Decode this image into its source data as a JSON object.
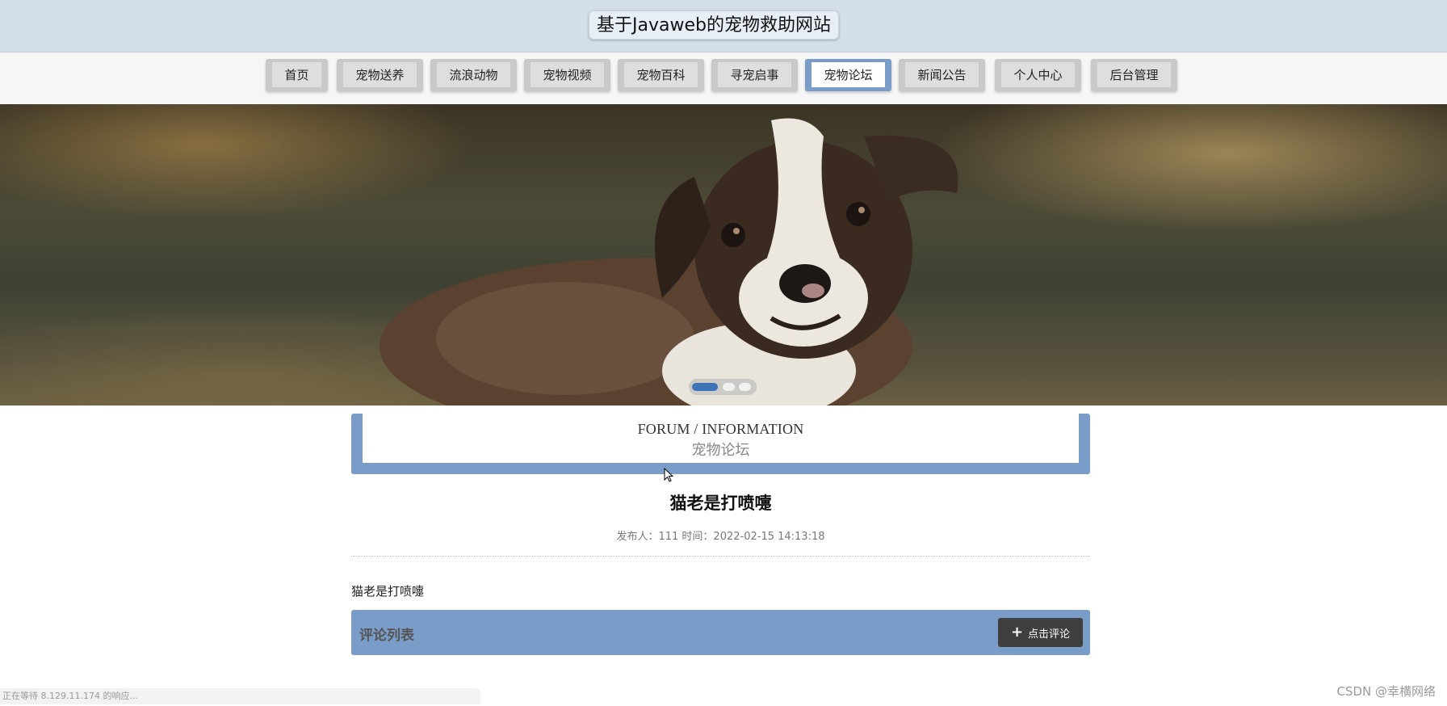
{
  "header": {
    "title": "基于Javaweb的宠物救助网站"
  },
  "nav": {
    "items": [
      {
        "label": "首页"
      },
      {
        "label": "宠物送养"
      },
      {
        "label": "流浪动物"
      },
      {
        "label": "宠物视频"
      },
      {
        "label": "宠物百科"
      },
      {
        "label": "寻宠启事"
      },
      {
        "label": "宠物论坛",
        "active": true
      },
      {
        "label": "新闻公告"
      },
      {
        "label": "个人中心"
      },
      {
        "label": "后台管理"
      }
    ]
  },
  "banner": {
    "image": "puppy-photo",
    "slides": 3,
    "active_slide": 1
  },
  "section": {
    "en": "FORUM / INFORMATION",
    "cn": "宠物论坛"
  },
  "article": {
    "title": "猫老是打喷嚏",
    "meta": "发布人：111 时间：2022-02-15 14:13:18",
    "body": "猫老是打喷嚏"
  },
  "comments": {
    "title": "评论列表",
    "button_label": "点击评论",
    "button_icon": "plus-icon"
  },
  "status_bar": {
    "text": "正在等待 8.129.11.174 的响应..."
  },
  "watermark": {
    "text": "CSDN @幸横网络"
  },
  "colors": {
    "header_bg": "#d4dfe9",
    "accent": "#7a9cc8",
    "active_dot": "#3d74b6",
    "button_dark": "#3f3f3f"
  }
}
